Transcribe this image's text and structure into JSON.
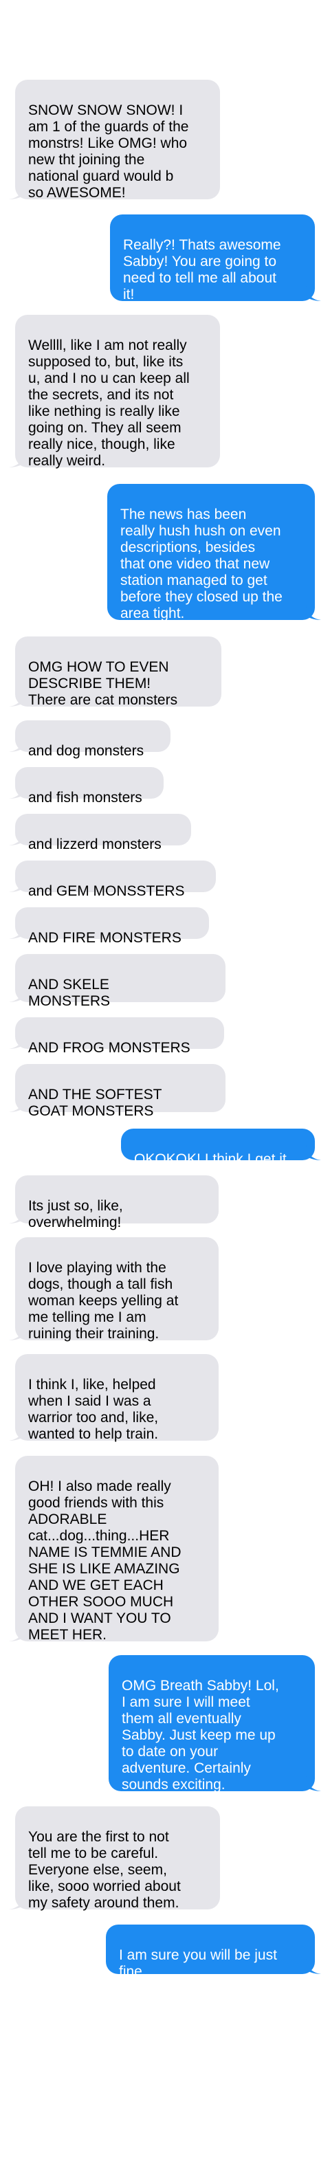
{
  "colors": {
    "incoming_bubble": "#e5e5ea",
    "outgoing_bubble": "#1d8bf1",
    "incoming_text": "#000000",
    "outgoing_text": "#ffffff",
    "background": "#ffffff"
  },
  "messages": [
    {
      "from": "them",
      "text": "SNOW SNOW SNOW! I\nam 1 of the guards of the\nmonstrs! Like OMG! who\nnew tht joining the\nnational guard would b\nso AWESOME!"
    },
    {
      "from": "me",
      "text": "Really?! Thats awesome\nSabby! You are going to\nneed to tell me all about\nit!"
    },
    {
      "from": "them",
      "text": "Wellll, like I am not really\nsupposed to, but, like its\nu, and I no u can keep all\nthe secrets, and its not\nlike nething is really like\ngoing on. They all seem\nreally nice, though, like\nreally weird."
    },
    {
      "from": "me",
      "text": "The news has been\nreally hush hush on even\ndescriptions, besides\nthat one video that new\nstation managed to get\nbefore they closed up the\narea tight."
    },
    {
      "from": "them",
      "text": "OMG HOW TO EVEN\nDESCRIBE THEM!\nThere are cat monsters"
    },
    {
      "from": "them",
      "text": "and dog monsters"
    },
    {
      "from": "them",
      "text": "and fish monsters"
    },
    {
      "from": "them",
      "text": "and lizzerd monsters"
    },
    {
      "from": "them",
      "text": "and GEM MONSSTERS"
    },
    {
      "from": "them",
      "text": "AND FIRE MONSTERS"
    },
    {
      "from": "them",
      "text": "AND SKELE\nMONSTERS"
    },
    {
      "from": "them",
      "text": "AND FROG MONSTERS"
    },
    {
      "from": "them",
      "text": "AND THE SOFTEST\nGOAT MONSTERS"
    },
    {
      "from": "me",
      "text": "OKOKOK! I think I get it"
    },
    {
      "from": "them",
      "text": "Its just so, like,\noverwhelming!"
    },
    {
      "from": "them",
      "text": "I love playing with the\ndogs, though a tall fish\nwoman keeps yelling at\nme telling me I am\nruining their training."
    },
    {
      "from": "them",
      "text": "I think I, like, helped\nwhen I said I was a\nwarrior too and, like,\nwanted to help train."
    },
    {
      "from": "them",
      "text": "OH! I also made really\ngood friends with this\nADORABLE\ncat...dog...thing...HER\nNAME IS TEMMIE AND\nSHE IS LIKE AMAZING\nAND WE GET EACH\nOTHER SOOO MUCH\nAND I WANT YOU TO\nMEET HER."
    },
    {
      "from": "me",
      "text": "OMG Breath Sabby! Lol,\nI am sure I will meet\nthem all eventually\nSabby. Just keep me up\nto date on your\nadventure. Certainly\nsounds exciting."
    },
    {
      "from": "them",
      "text": "You are the first to not\ntell me to be careful.\nEveryone else, seem,\nlike, sooo worried about\nmy safety around them."
    },
    {
      "from": "me",
      "text": "I am sure you will be just\nfine."
    }
  ]
}
